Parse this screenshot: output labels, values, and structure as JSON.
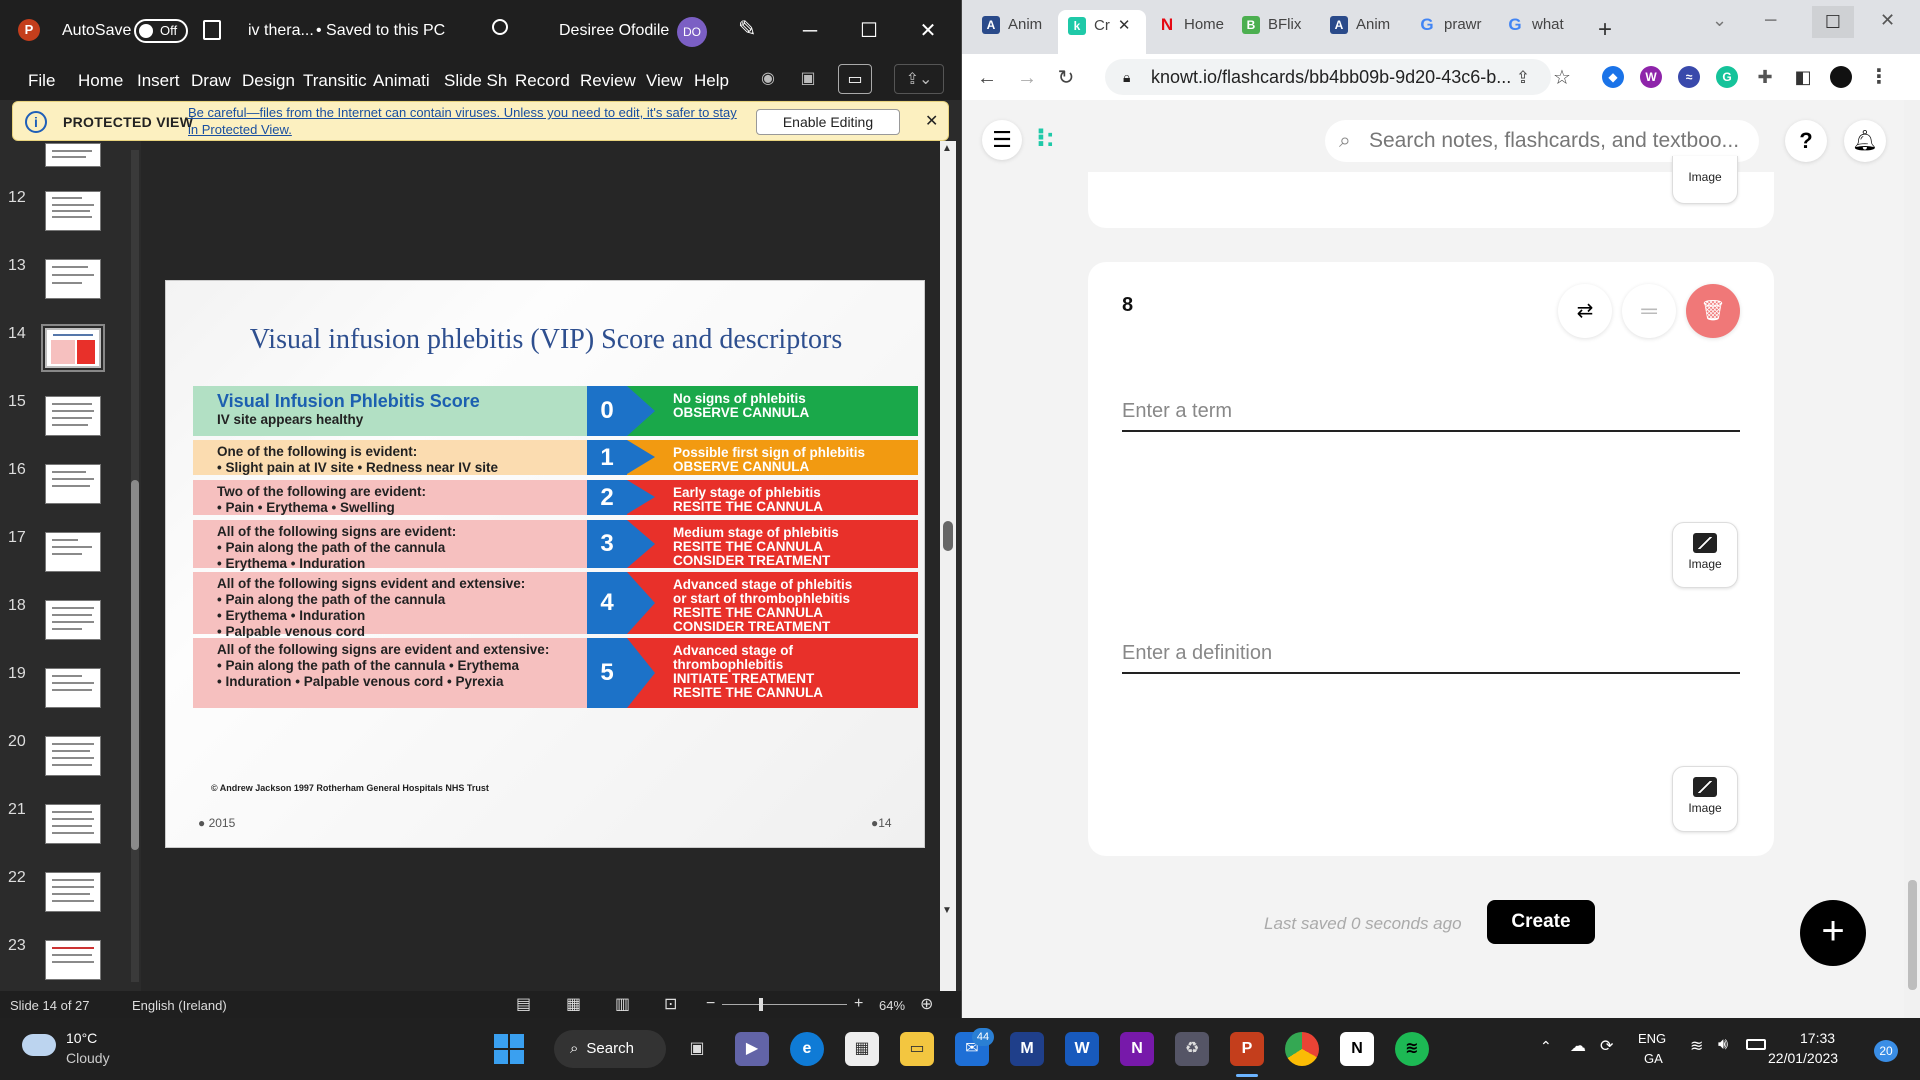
{
  "ppt": {
    "title_bar": {
      "app_icon": "P",
      "autosave_label": "AutoSave",
      "autosave_state": "Off",
      "save_icon": "save-icon",
      "filename": "iv thera...",
      "saved_status": "• Saved to this PC",
      "search_icon": "search-icon",
      "user_name": "Desiree Ofodile",
      "user_initials": "DO",
      "pen_icon": "pen-icon",
      "minimize": "─",
      "maximize": "☐",
      "close": "✕"
    },
    "ribbon": {
      "menus": [
        "File",
        "Home",
        "Insert",
        "Draw",
        "Design",
        "Transitic",
        "Animati",
        "Slide Sh",
        "Record",
        "Review",
        "View",
        "Help"
      ]
    },
    "protected_view": {
      "title": "PROTECTED VIEW",
      "message": "Be careful—files from the Internet can contain viruses. Unless you need to edit, it's safer to stay in Protected View.",
      "button": "Enable Editing",
      "close": "✕"
    },
    "thumbnails": [
      "12",
      "13",
      "14",
      "15",
      "16",
      "17",
      "18",
      "19",
      "20",
      "21",
      "22",
      "23"
    ],
    "selected_thumbnail": "14",
    "slide": {
      "title": "Visual infusion phlebitis (VIP) Score and descriptors",
      "rows": [
        {
          "score": "0",
          "left_title": "Visual Infusion Phlebitis Score",
          "left_lines": [
            "IV site appears healthy"
          ],
          "right_lines": [
            "No signs of phlebitis"
          ],
          "right_actions": [
            "OBSERVE CANNULA"
          ],
          "color": "#1aa84a",
          "left_bg": "#b2e0c4"
        },
        {
          "score": "1",
          "left_title": "",
          "left_lines": [
            "One of the following is evident:",
            "• Slight pain at IV site     • Redness near IV site"
          ],
          "right_lines": [
            "Possible first sign of phlebitis"
          ],
          "right_actions": [
            "OBSERVE CANNULA"
          ],
          "color": "#f29a11",
          "left_bg": "#fbdcb0"
        },
        {
          "score": "2",
          "left_title": "",
          "left_lines": [
            "Two of the following are evident:",
            "• Pain     • Erythema     • Swelling"
          ],
          "right_lines": [
            "Early stage of phlebitis"
          ],
          "right_actions": [
            "RESITE THE CANNULA"
          ],
          "color": "#e8302a",
          "left_bg": "#f6c0bf"
        },
        {
          "score": "3",
          "left_title": "",
          "left_lines": [
            "All of the following signs are evident:",
            "• Pain along the path of the cannula",
            "• Erythema     • Induration"
          ],
          "right_lines": [
            "Medium stage of phlebitis"
          ],
          "right_actions": [
            "RESITE THE CANNULA",
            "CONSIDER TREATMENT"
          ],
          "color": "#e8302a",
          "left_bg": "#f6c0bf"
        },
        {
          "score": "4",
          "left_title": "",
          "left_lines": [
            "All of the following signs evident and extensive:",
            "• Pain along the path of the cannula",
            "• Erythema     • Induration",
            "• Palpable venous cord"
          ],
          "right_lines": [
            "Advanced stage of phlebitis",
            "or start of thrombophlebitis"
          ],
          "right_actions": [
            "RESITE THE CANNULA",
            "CONSIDER TREATMENT"
          ],
          "color": "#e8302a",
          "left_bg": "#f6c0bf"
        },
        {
          "score": "5",
          "left_title": "",
          "left_lines": [
            "All of the following signs are evident and extensive:",
            "• Pain along the path of the cannula     • Erythema",
            "• Induration     • Palpable venous cord     • Pyrexia"
          ],
          "right_lines": [
            "Advanced stage of",
            "thrombophlebitis"
          ],
          "right_actions": [
            "INITIATE TREATMENT",
            "RESITE THE CANNULA"
          ],
          "color": "#e8302a",
          "left_bg": "#f6c0bf"
        }
      ],
      "copyright": "© Andrew Jackson 1997 Rotherham General Hospitals NHS Trust",
      "footer_left": "● 2015",
      "footer_right": "●14"
    },
    "status": {
      "slide_info": "Slide 14 of 27",
      "language": "English (Ireland)",
      "zoom_minus": "−",
      "zoom_plus": "+",
      "zoom": "64%"
    }
  },
  "chrome": {
    "tabs": [
      {
        "label": "Anim",
        "icon": "A",
        "color": "#2a4a8a"
      },
      {
        "label": "Cr",
        "icon": "k",
        "color": "#1fc9a8",
        "active": true
      },
      {
        "label": "Home",
        "icon": "N",
        "color": "#e50914"
      },
      {
        "label": "BFlix",
        "icon": "B",
        "color": "#4caf50"
      },
      {
        "label": "Anim",
        "icon": "A",
        "color": "#2a4a8a"
      },
      {
        "label": "prawr",
        "icon": "G",
        "color": "#4285f4"
      },
      {
        "label": "what",
        "icon": "G",
        "color": "#4285f4"
      }
    ],
    "new_tab": "+",
    "url": "knowt.io/flashcards/bb4bb09b-9d20-43c6-b...",
    "window": {
      "minimize": "─",
      "maximize": "☐",
      "close": "✕",
      "dropdown": "⌄"
    },
    "page": {
      "search_placeholder": "Search notes, flashcards, and textboo...",
      "help": "?",
      "prev_card_image": "Image",
      "card_number": "8",
      "term_placeholder": "Enter a term",
      "definition_placeholder": "Enter a definition",
      "image_label": "Image",
      "last_saved": "Last saved 0 seconds ago",
      "create": "Create",
      "fab": "+"
    }
  },
  "taskbar": {
    "weather_temp": "10°C",
    "weather_desc": "Cloudy",
    "search": "Search",
    "mail_badge": "44",
    "lang1": "ENG",
    "lang2": "GA",
    "time": "17:33",
    "date": "22/01/2023",
    "notif": "20"
  }
}
